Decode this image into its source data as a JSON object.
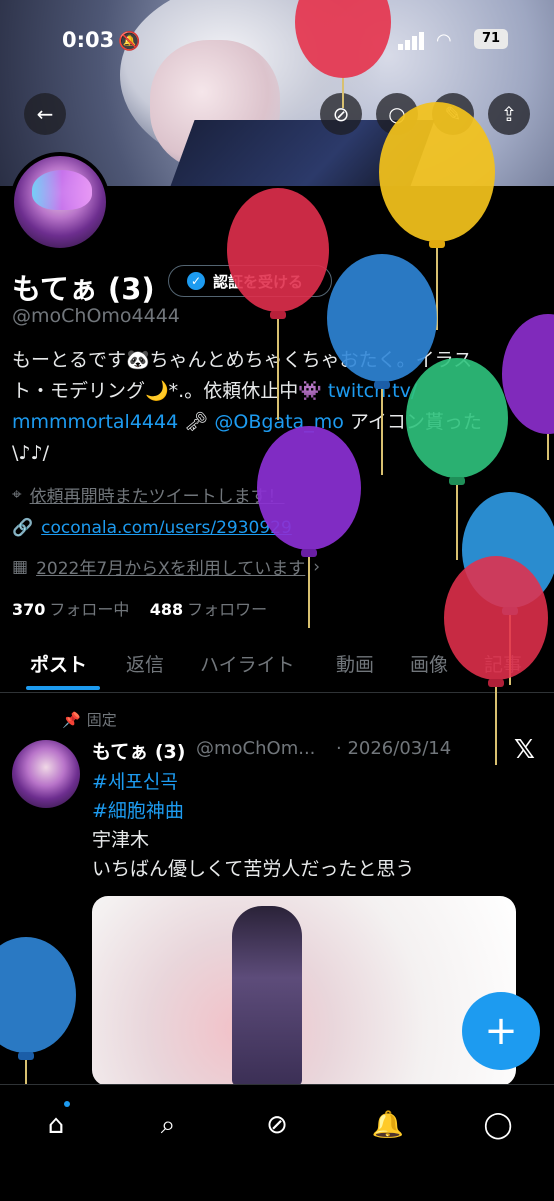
{
  "status_bar": {
    "time": "0:03",
    "battery": "71"
  },
  "profile": {
    "name": "もてぁ (3)",
    "verify_button": "認証を受ける",
    "handle": "@moChOmo4444",
    "bio": {
      "line1": "もーとるです🐼ちゃんとめちゃくちゃおたく。イラス",
      "line2_text": "ト・モデリング🌙*.。依頼休止中👾 ",
      "line2_link": "twitch.tv/",
      "line3_link1": "mmmmortal4444",
      "line3_mid": " 🗝 ",
      "line3_link2": "@OBgata_mo",
      "line3_tail": " アイコン貰った",
      "line4": "\\♪♪/"
    },
    "location": "依頼再開時またツイートします！",
    "website": "coconala.com/users/2930929",
    "joined": "2022年7月からXを利用しています",
    "following_count": "370",
    "following_label": "フォロー中",
    "followers_count": "488",
    "followers_label": "フォロワー"
  },
  "tabs": [
    "ポスト",
    "返信",
    "ハイライト",
    "動画",
    "画像",
    "記事"
  ],
  "pinned_post": {
    "pinned_label": "固定",
    "author": "もてぁ (3)",
    "handle": "@moChOm...",
    "date": "· 2026/03/14",
    "hashtag1": "#세포신곡",
    "hashtag2": "#細胞神曲",
    "line1": "宇津木",
    "line2": "いちばん優しくて苦労人だったと思う"
  },
  "colors": {
    "accent": "#1d9bf0",
    "background": "#000000",
    "muted": "#71767b"
  },
  "icons": {
    "back": "arrow-left-icon",
    "grok": "grok-icon",
    "search": "search-icon",
    "edit": "pencil-icon",
    "share": "share-icon",
    "nav": [
      "home-icon",
      "search-icon",
      "grok-icon",
      "bell-icon",
      "messages-icon"
    ]
  }
}
